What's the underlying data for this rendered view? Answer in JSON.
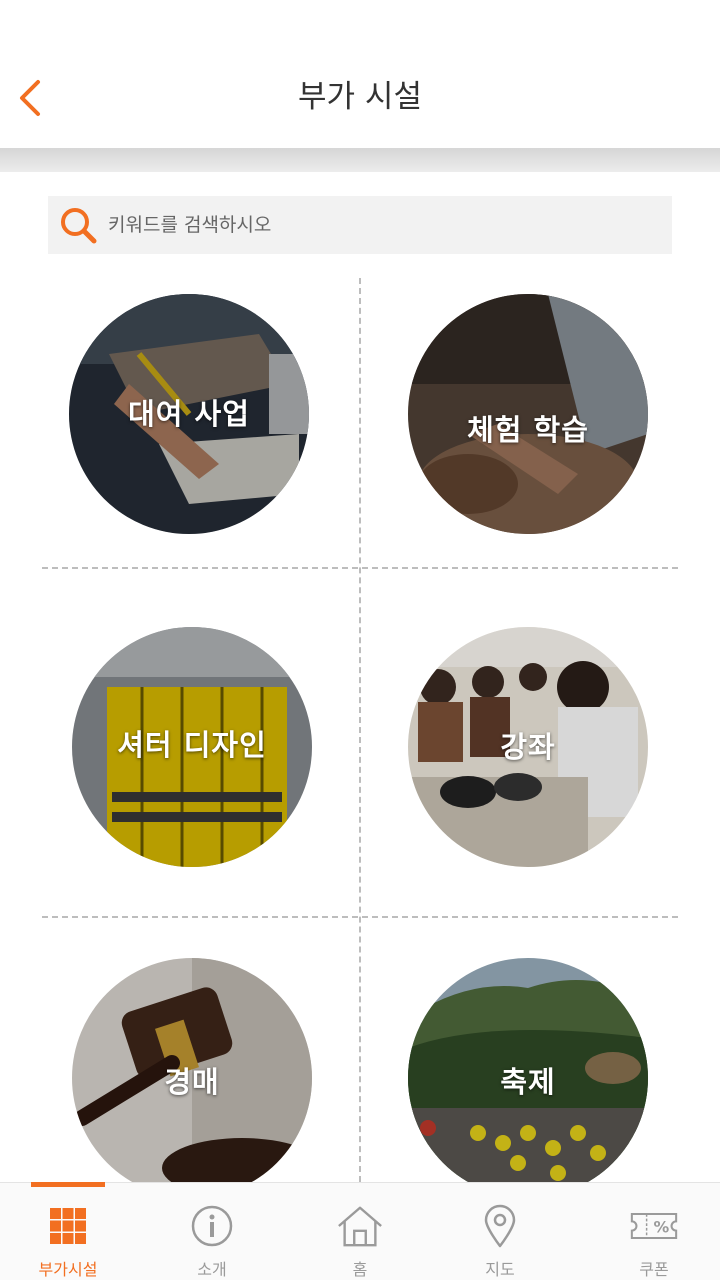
{
  "colors": {
    "accent": "#f26f21",
    "inactive": "#9a9a9a"
  },
  "header": {
    "title": "부가 시설",
    "back_icon": "chevron-left-icon"
  },
  "search": {
    "placeholder": "키워드를 검색하시오",
    "icon": "search-icon"
  },
  "categories": [
    {
      "label": "대여 사업"
    },
    {
      "label": "체험 학습"
    },
    {
      "label": "셔터 디자인"
    },
    {
      "label": "강좌"
    },
    {
      "label": "경매"
    },
    {
      "label": "축제"
    }
  ],
  "nav": {
    "items": [
      {
        "label": "부가시설",
        "icon": "grid-icon",
        "active": true
      },
      {
        "label": "소개",
        "icon": "info-icon",
        "active": false
      },
      {
        "label": "홈",
        "icon": "home-icon",
        "active": false
      },
      {
        "label": "지도",
        "icon": "map-pin-icon",
        "active": false
      },
      {
        "label": "쿠폰",
        "icon": "coupon-icon",
        "active": false
      }
    ]
  }
}
